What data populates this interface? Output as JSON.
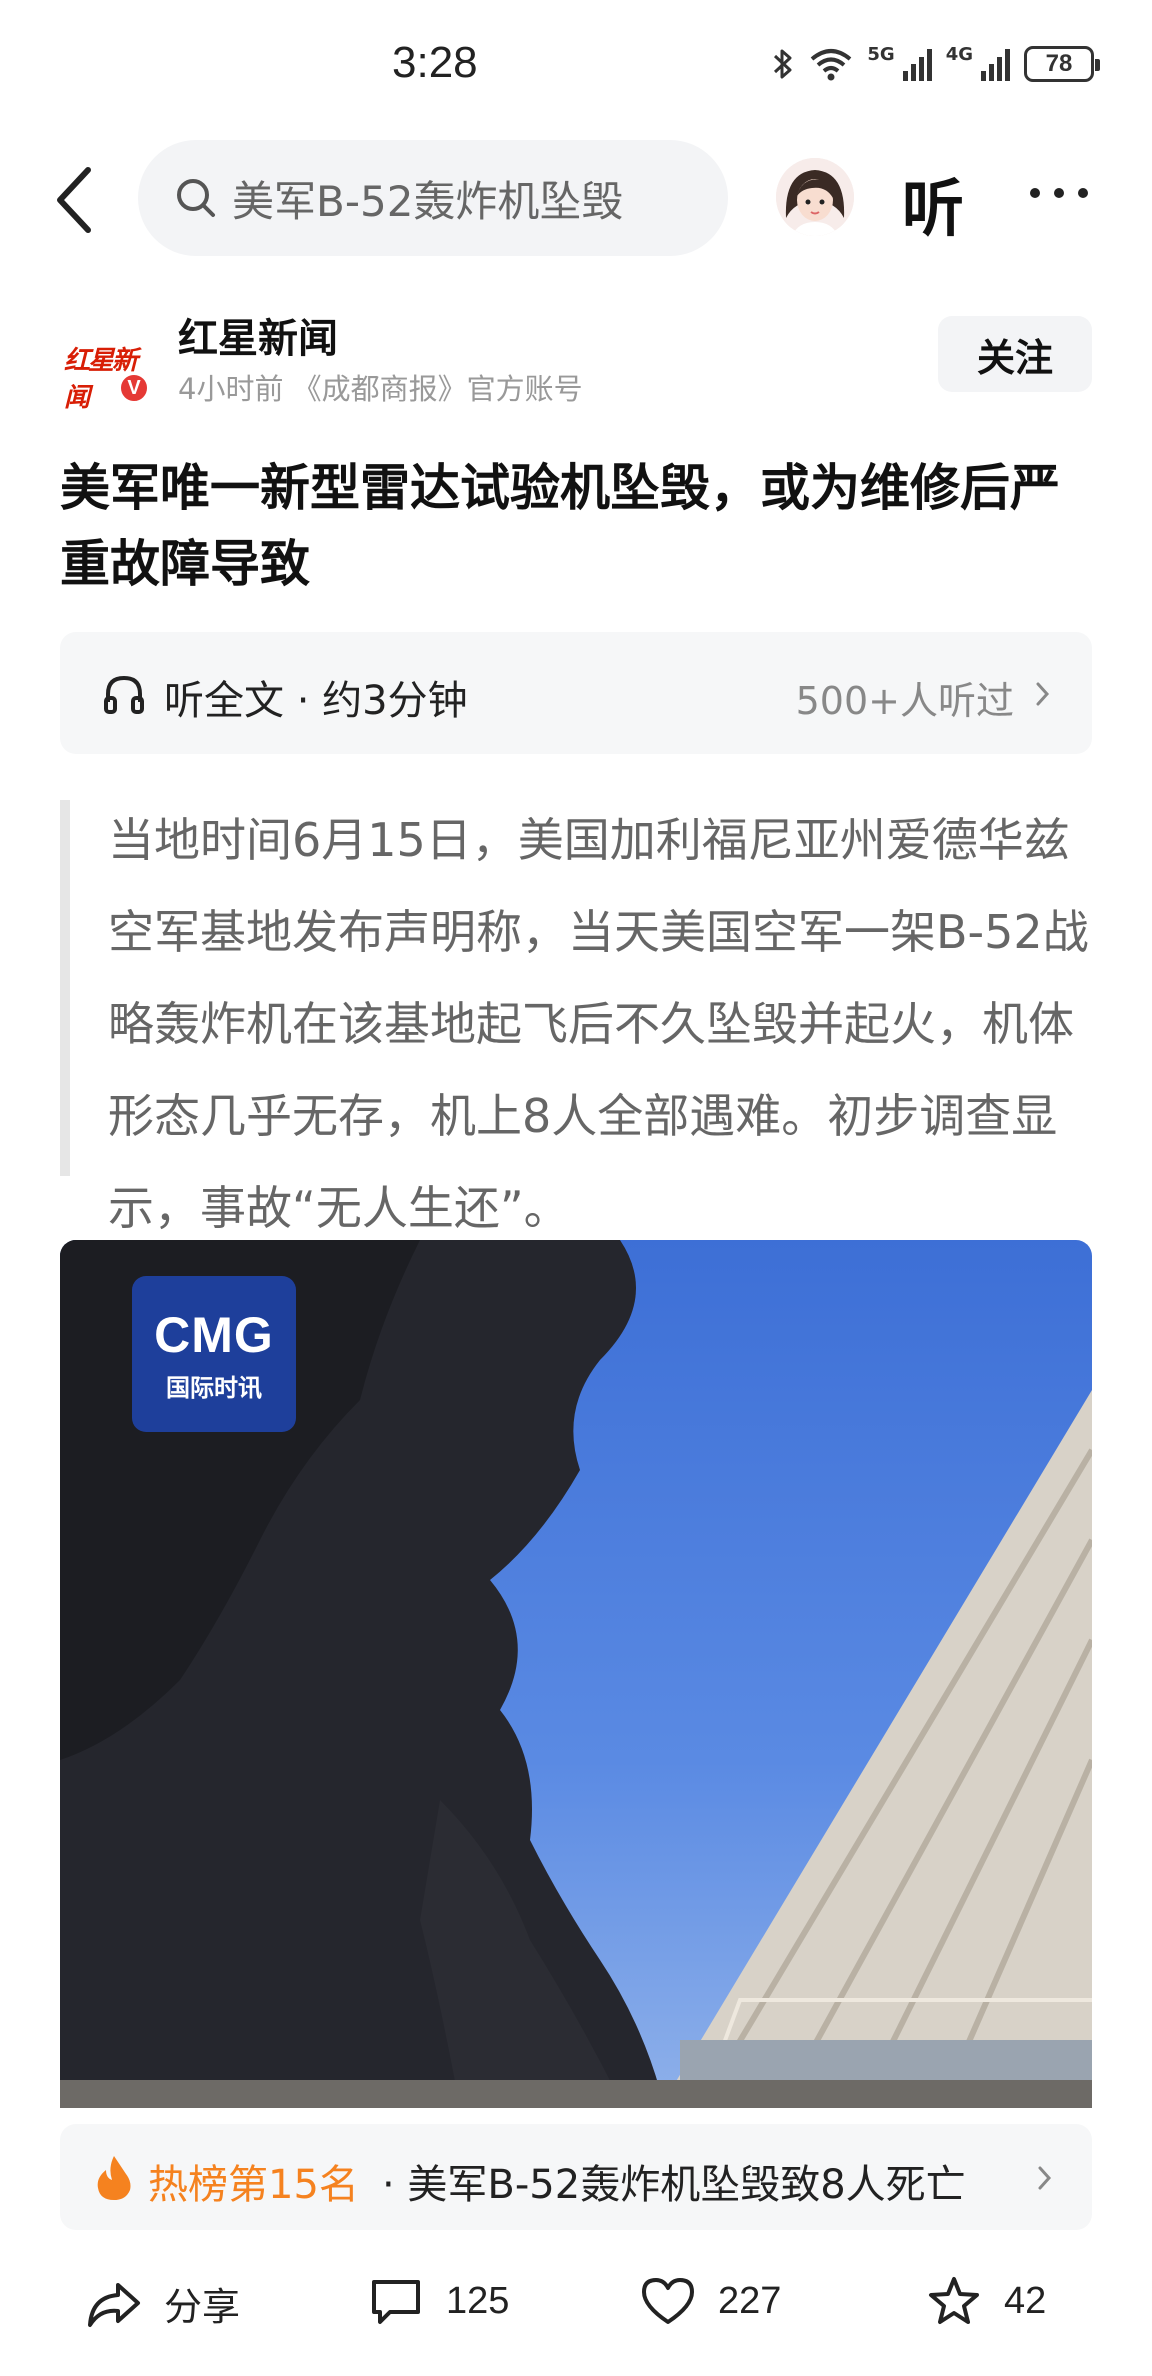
{
  "status_bar": {
    "time": "3:28",
    "battery": "78",
    "network_labels": [
      "5G",
      "4G"
    ]
  },
  "top_nav": {
    "search_text": "美军B-52轰炸机坠毁",
    "listen_label": "听"
  },
  "author": {
    "logo_text": "红星新闻",
    "verified_badge": "V",
    "name": "红星新闻",
    "meta": "4小时前   《成都商报》官方账号",
    "follow_label": "关注"
  },
  "article": {
    "title": "美军唯一新型雷达试验机坠毁，或为维修后严重故障导致",
    "listen": {
      "label": "听全文 · 约3分钟",
      "count": "500+人听过"
    },
    "quote": "当地时间6月15日，美国加利福尼亚州爱德华兹空军基地发布声明称，当天美国空军一架B-52战略轰炸机在该基地起飞后不久坠毁并起火，机体形态几乎无存，机上8人全部遇难。初步调查显示，事故“无人生还”。",
    "image": {
      "logo_main": "CMG",
      "logo_sub": "国际时讯"
    }
  },
  "hot_rank": {
    "rank": "热榜第15名",
    "title": "·  美军B-52轰炸机坠毁致8人死亡"
  },
  "actions": {
    "share_label": "分享",
    "comment_count": "125",
    "like_count": "227",
    "favorite_count": "42"
  },
  "colors": {
    "accent_orange": "#f5821f",
    "brand_red": "#d81e06",
    "cmg_blue": "#1e3f9b"
  }
}
